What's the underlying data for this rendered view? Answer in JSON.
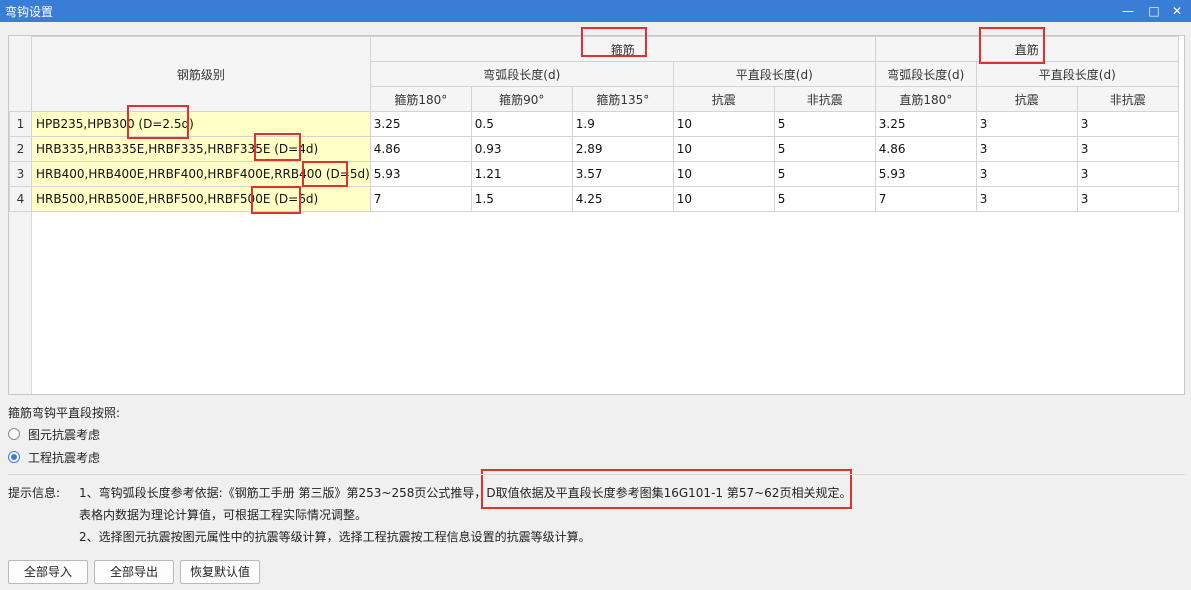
{
  "window": {
    "title": "弯钩设置",
    "min_icon": "minimize-icon",
    "max_icon": "maximize-icon",
    "close_icon": "close-icon"
  },
  "table": {
    "grade_header": "钢筋级别",
    "stirrup_group": "箍筋",
    "straight_group": "直筋",
    "stirrup_arc": "弯弧段长度(d)",
    "stirrup_flat": "平直段长度(d)",
    "straight_arc": "弯弧段长度(d)",
    "straight_flat": "平直段长度(d)",
    "col_180": "箍筋180°",
    "col_90": "箍筋90°",
    "col_135": "箍筋135°",
    "col_seismic": "抗震",
    "col_nonseismic": "非抗震",
    "col_straight180": "直筋180°",
    "col_seismic2": "抗震",
    "col_nonseismic2": "非抗震",
    "rows": [
      {
        "num": "1",
        "grade": "HPB235,HPB300 (D=2.5d)",
        "s180": "3.25",
        "s90": "0.5",
        "s135": "1.9",
        "sz": "10",
        "snz": "5",
        "z180": "3.25",
        "zz": "3",
        "znz": "3"
      },
      {
        "num": "2",
        "grade": "HRB335,HRB335E,HRBF335,HRBF335E (D=4d)",
        "s180": "4.86",
        "s90": "0.93",
        "s135": "2.89",
        "sz": "10",
        "snz": "5",
        "z180": "4.86",
        "zz": "3",
        "znz": "3"
      },
      {
        "num": "3",
        "grade": "HRB400,HRB400E,HRBF400,HRBF400E,RRB400 (D=5d)",
        "s180": "5.93",
        "s90": "1.21",
        "s135": "3.57",
        "sz": "10",
        "snz": "5",
        "z180": "5.93",
        "zz": "3",
        "znz": "3"
      },
      {
        "num": "4",
        "grade": "HRB500,HRB500E,HRBF500,HRBF500E (D=6d)",
        "s180": "7",
        "s90": "1.5",
        "s135": "4.25",
        "sz": "10",
        "snz": "5",
        "z180": "7",
        "zz": "3",
        "znz": "3"
      }
    ]
  },
  "options": {
    "label": "箍筋弯钩平直段按照:",
    "opt1": "图元抗震考虑",
    "opt2": "工程抗震考虑",
    "selected": "工程抗震考虑"
  },
  "tips": {
    "label": "提示信息:",
    "line1": "1、弯钩弧段长度参考依据:《钢筋工手册 第三版》第253~258页公式推导，D取值依据及平直段长度参考图集16G101-1 第57~62页相关规定。",
    "line2": "表格内数据为理论计算值，可根据工程实际情况调整。",
    "line3": "2、选择图元抗震按图元属性中的抗震等级计算，选择工程抗震按工程信息设置的抗震等级计算。"
  },
  "buttons": {
    "import_all": "全部导入",
    "export_all": "全部导出",
    "restore": "恢复默认值"
  },
  "colors": {
    "titlebar": "#3a7dd6",
    "highlight": "#e03131",
    "grade_cell": "#ffffc6"
  }
}
